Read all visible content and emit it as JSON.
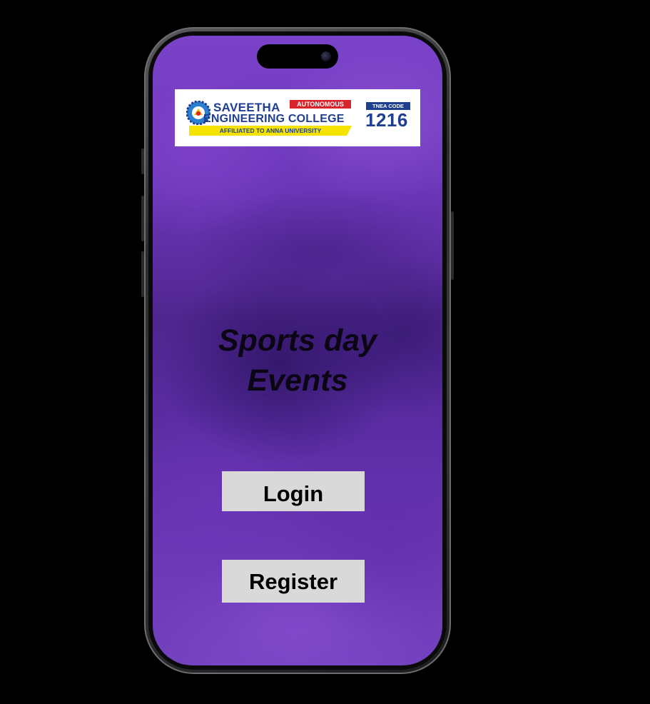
{
  "college": {
    "name_line1": "SAVEETHA",
    "name_line2": "ENGINEERING COLLEGE",
    "status_badge": "AUTONOMOUS",
    "affiliation": "AFFILIATED TO ANNA UNIVERSITY",
    "tnea_label": "TNEA CODE",
    "tnea_code": "1216"
  },
  "main": {
    "title_line1": "Sports day",
    "title_line2": "Events"
  },
  "actions": {
    "login_label": "Login",
    "register_label": "Register"
  },
  "colors": {
    "background": "#000000",
    "screen_purple": "#6e38bc",
    "button_gray": "#d9d9d9",
    "brand_blue": "#1e3f8f",
    "badge_red": "#d8232a",
    "badge_yellow": "#f4e300"
  },
  "icons": {
    "logo": "college-emblem-icon",
    "camera": "front-camera-icon"
  }
}
